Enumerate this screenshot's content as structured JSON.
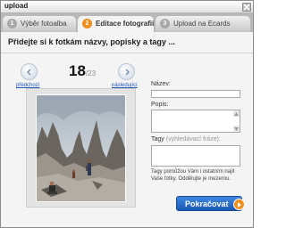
{
  "window": {
    "title": "upload"
  },
  "tabs": [
    {
      "number": "1",
      "label": "Výběr fotoalba",
      "active": false
    },
    {
      "number": "2",
      "label": "Editace fotografií",
      "active": true
    },
    {
      "number": "3",
      "label": "Upload na Ecards",
      "active": false
    }
  ],
  "heading": "Přidejte si k fotkám názvy, popisky a tagy ...",
  "navigation": {
    "prev_label": "předchozí",
    "next_label": "následující",
    "current": "18",
    "total": "/23"
  },
  "form": {
    "name_label": "Název:",
    "name_value": "",
    "description_label": "Popis:",
    "description_value": "",
    "tags_label": "Tagy",
    "tags_hint": "(vyhledávací fráze):",
    "tags_value": "",
    "help_text": "Tagy pomůžou Vám i ostatním najít Vaše fotky. Oddělujte je mezerou."
  },
  "continue_label": "Pokračovat",
  "colors": {
    "accent": "#f28f1c",
    "button_blue": "#1f62c2",
    "tab_bar": "#b9b9b9",
    "link": "#1d56b8"
  },
  "icons": {
    "close": "close-icon",
    "prev": "arrow-left-icon",
    "next": "arrow-right-icon",
    "continue": "arrow-right-icon"
  }
}
